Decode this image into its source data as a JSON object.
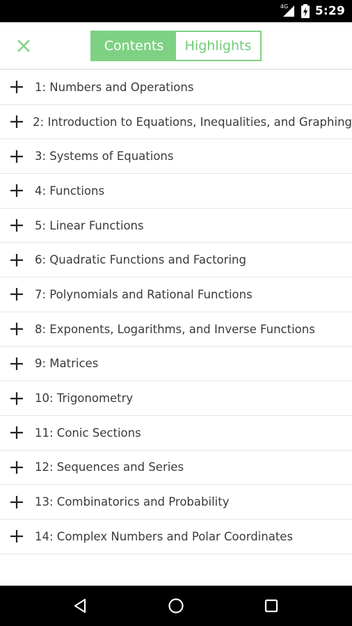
{
  "status_bar": {
    "network_label": "4G",
    "time": "5:29"
  },
  "toolbar": {
    "close_icon": "close-icon",
    "tabs": [
      {
        "label": "Contents",
        "active": true
      },
      {
        "label": "Highlights",
        "active": false
      }
    ]
  },
  "chapters": [
    "1: Numbers and Operations",
    "2: Introduction to Equations, Inequalities, and Graphing",
    "3: Systems of Equations",
    "4: Functions",
    "5: Linear Functions",
    "6: Quadratic Functions and Factoring",
    "7: Polynomials and Rational Functions",
    "8: Exponents, Logarithms, and Inverse Functions",
    "9: Matrices",
    "10: Trigonometry",
    "11: Conic Sections",
    "12: Sequences and Series",
    "13: Combinatorics and Probability",
    "14: Complex Numbers and Polar Coordinates"
  ],
  "nav_bar": {
    "icons": [
      "back-icon",
      "home-icon",
      "recents-icon"
    ]
  },
  "colors": {
    "accent": "#7ed183",
    "text": "#3a3a3a",
    "divider": "#e6e6e6"
  }
}
